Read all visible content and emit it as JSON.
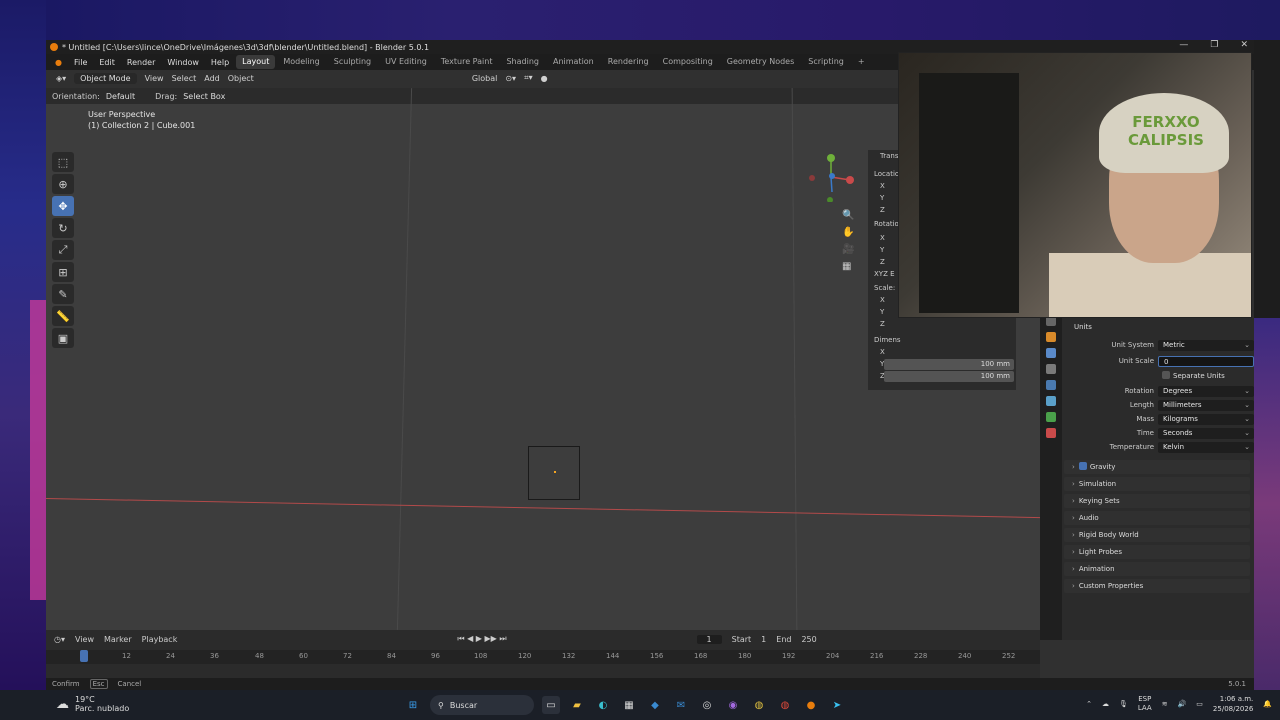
{
  "window": {
    "title": "* Untitled [C:\\Users\\lince\\OneDrive\\Imágenes\\3d\\3df\\blender\\Untitled.blend] - Blender 5.0.1",
    "controls": [
      "—",
      "❐",
      "✕"
    ]
  },
  "menu": [
    "File",
    "Edit",
    "Render",
    "Window",
    "Help"
  ],
  "workspaces": [
    "Layout",
    "Modeling",
    "Sculpting",
    "UV Editing",
    "Texture Paint",
    "Shading",
    "Animation",
    "Rendering",
    "Compositing",
    "Geometry Nodes",
    "Scripting",
    "+"
  ],
  "header": {
    "mode": "Object Mode",
    "menus": [
      "View",
      "Select",
      "Add",
      "Object"
    ],
    "transform_orientation": "Global"
  },
  "toolheader": {
    "orientation_label": "Orientation:",
    "orientation_value": "Default",
    "drag_label": "Drag:",
    "drag_value": "Select Box"
  },
  "viewport": {
    "view_name": "User Perspective",
    "collection_info": "(1) Collection 2 | Cube.001"
  },
  "npanel": {
    "tab": "Trans",
    "location": "Location",
    "rotation": "Rotation",
    "rotation_mode": "XYZ E",
    "scale": "Scale:",
    "dimensions": "Dimens",
    "axes": [
      "X",
      "Y",
      "Z"
    ],
    "dim_y": "100 mm",
    "dim_z": "100 mm"
  },
  "properties": {
    "section": "Units",
    "unit_system_label": "Unit System",
    "unit_system_value": "Metric",
    "unit_scale_label": "Unit Scale",
    "unit_scale_value": "0",
    "separate_units": "Separate Units",
    "rotation_label": "Rotation",
    "rotation_value": "Degrees",
    "length_label": "Length",
    "length_value": "Millimeters",
    "mass_label": "Mass",
    "mass_value": "Kilograms",
    "time_label": "Time",
    "time_value": "Seconds",
    "temperature_label": "Temperature",
    "temperature_value": "Kelvin",
    "panels": [
      "Gravity",
      "Simulation",
      "Keying Sets",
      "Audio",
      "Rigid Body World",
      "Light Probes",
      "Animation",
      "Custom Properties"
    ]
  },
  "timeline": {
    "menus": [
      "View",
      "Marker",
      "Playback"
    ],
    "current_frame": "1",
    "start_label": "Start",
    "start_value": "1",
    "end_label": "End",
    "end_value": "250",
    "ticks": [
      "1",
      "12",
      "24",
      "36",
      "48",
      "60",
      "72",
      "84",
      "96",
      "108",
      "120",
      "132",
      "144",
      "156",
      "168",
      "180",
      "192",
      "204",
      "216",
      "228",
      "240",
      "252"
    ]
  },
  "statusbar": {
    "confirm": "Confirm",
    "cancel_key": "Esc",
    "cancel": "Cancel",
    "version": "5.0.1"
  },
  "webcam": {
    "cap_text": "FERXXO CALIPSIS"
  },
  "taskbar": {
    "temperature": "19°C",
    "weather": "Parc. nublado",
    "search": "Buscar",
    "lang": "ESP",
    "lang2": "LAA",
    "time": "1:06 a.m.",
    "date": "25/08/2026"
  }
}
